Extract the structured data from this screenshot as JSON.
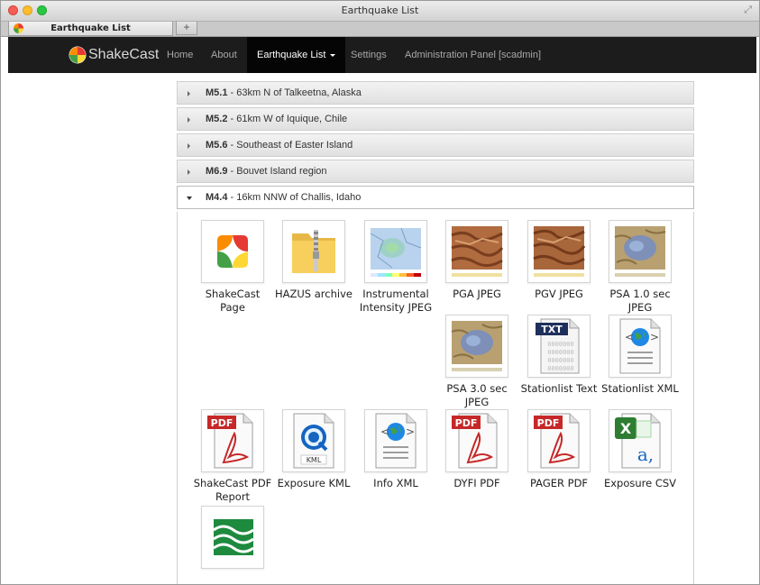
{
  "window": {
    "title": "Earthquake List"
  },
  "tab": {
    "label": "Earthquake List"
  },
  "newtab": {
    "label": "+"
  },
  "navbar": {
    "brand": "ShakeCast",
    "items": [
      {
        "label": "Home"
      },
      {
        "label": "About"
      },
      {
        "label": "Earthquake List"
      },
      {
        "label": "Settings"
      },
      {
        "label": "Administration Panel [scadmin]"
      }
    ]
  },
  "earthquakes": [
    {
      "mag": "M5.1",
      "location": " - 63km N of Talkeetna, Alaska"
    },
    {
      "mag": "M5.2",
      "location": " - 61km W of Iquique, Chile"
    },
    {
      "mag": "M5.6",
      "location": " - Southeast of Easter Island"
    },
    {
      "mag": "M6.9",
      "location": " - Bouvet Island region"
    },
    {
      "mag": "M4.4",
      "location": " - 16km NNW of Challis, Idaho"
    }
  ],
  "products": [
    {
      "label": "ShakeCast Page",
      "icon": "shakecast-logo-icon"
    },
    {
      "label": "HAZUS archive",
      "icon": "zip-folder-icon"
    },
    {
      "label": "Instrumental Intensity JPEG",
      "icon": "intensity-map-icon"
    },
    {
      "label": "PGA JPEG",
      "icon": "pga-map-icon"
    },
    {
      "label": "PGV JPEG",
      "icon": "pgv-map-icon"
    },
    {
      "label": "PSA 1.0 sec JPEG",
      "icon": "psa-map-icon"
    },
    {
      "label": "PSA 3.0 sec JPEG",
      "icon": "psa-map-icon"
    },
    {
      "label": "Stationlist Text",
      "icon": "txt-file-icon"
    },
    {
      "label": "Stationlist XML",
      "icon": "xml-file-icon"
    },
    {
      "label": "ShakeCast PDF Report",
      "icon": "pdf-file-icon"
    },
    {
      "label": "Exposure KML",
      "icon": "kml-file-icon"
    },
    {
      "label": "Info XML",
      "icon": "xml-file-icon"
    },
    {
      "label": "DYFI PDF",
      "icon": "pdf-file-icon"
    },
    {
      "label": "PAGER PDF",
      "icon": "pdf-file-icon"
    },
    {
      "label": "Exposure CSV",
      "icon": "excel-file-icon"
    },
    {
      "label": "",
      "icon": "green-wave-logo-icon"
    }
  ],
  "icon_labels": {
    "txt": "TXT",
    "pdf": "PDF",
    "kml": "KML",
    "xml_left": "<",
    "xml_right": ">",
    "csv_a": "a,",
    "excel_x": "X"
  },
  "colors": {
    "navbar": "#1c1c1c",
    "pdf_red": "#c62828",
    "kml_blue": "#1565c0",
    "excel_green": "#2e7d32"
  }
}
